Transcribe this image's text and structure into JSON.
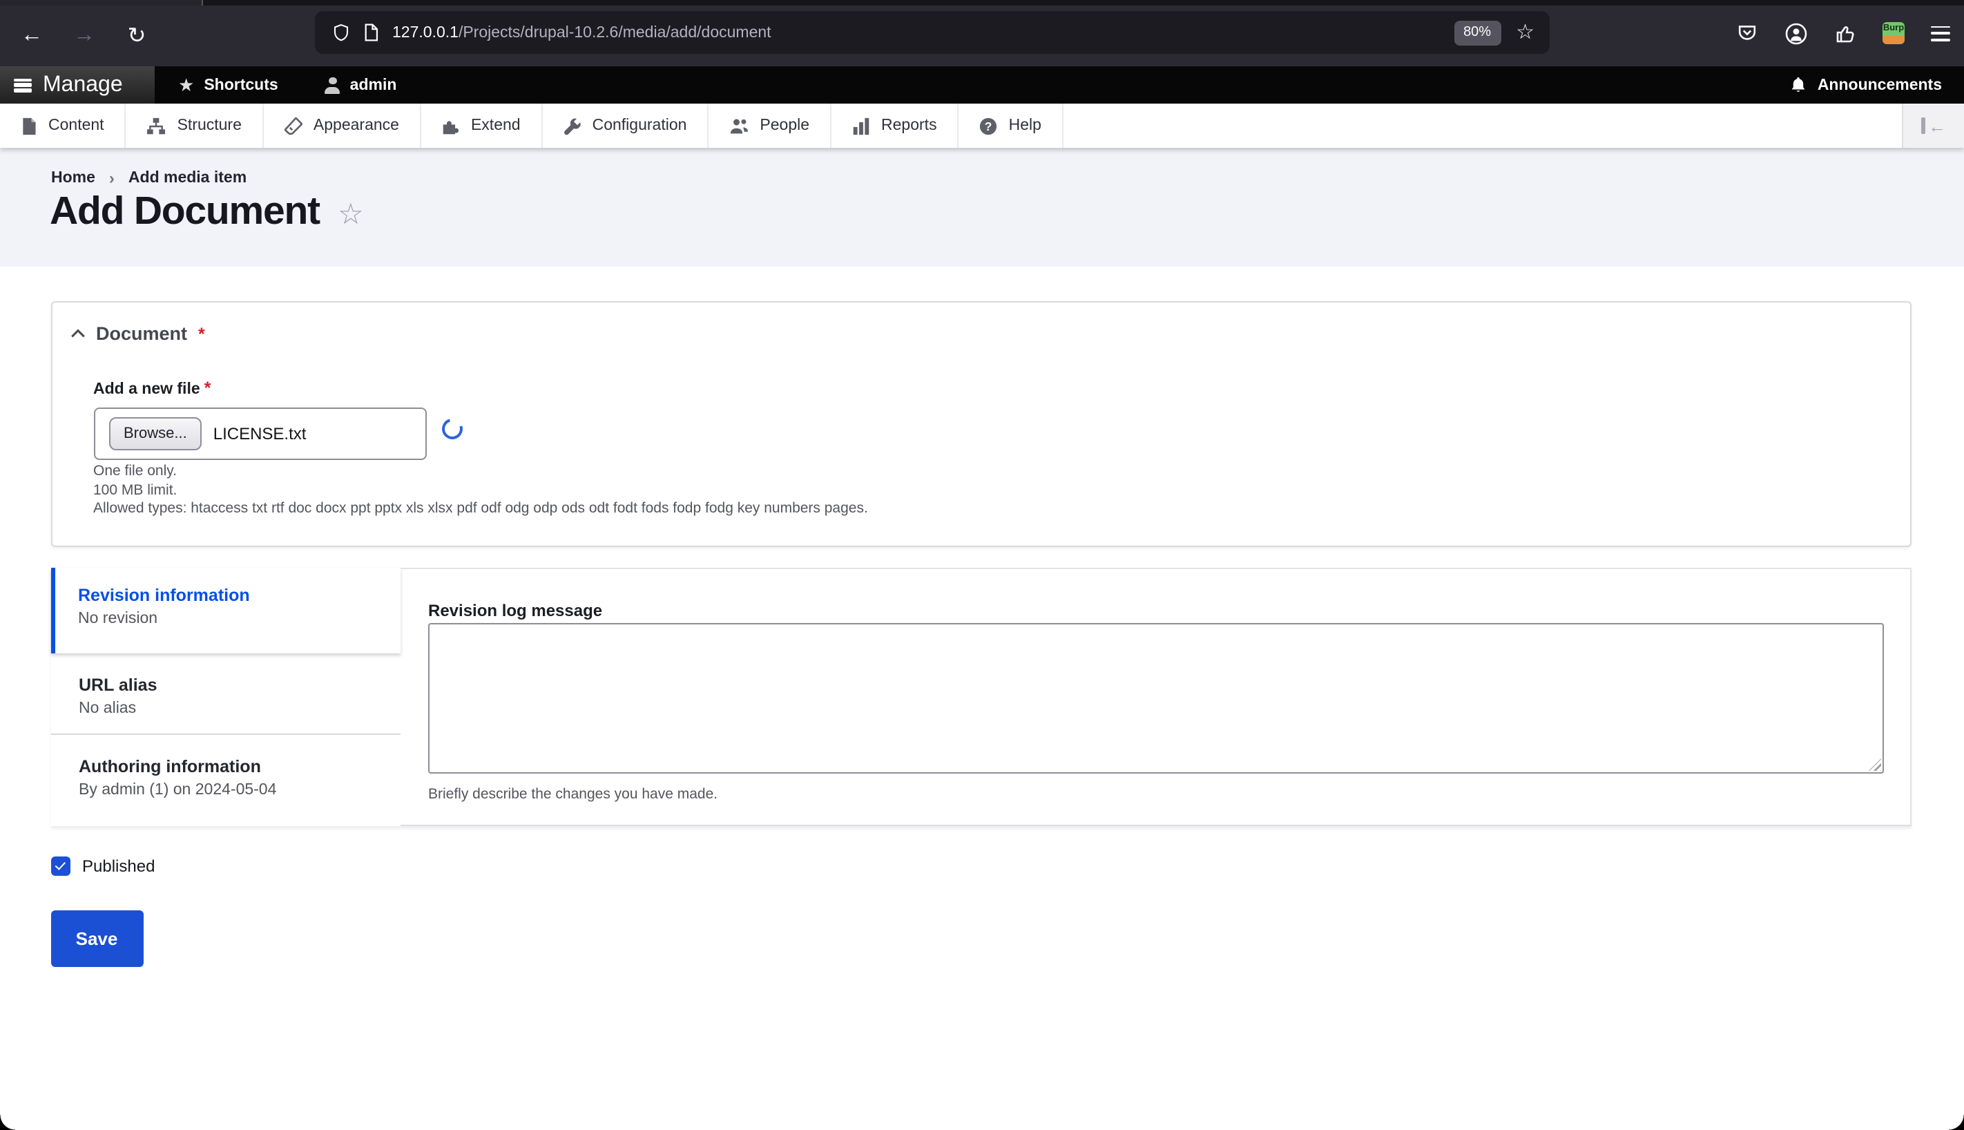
{
  "browser": {
    "url_host": "127.0.0.1",
    "url_path": "/Projects/drupal-10.2.6/media/add/document",
    "zoom_level": "80%",
    "extension_badge": "Burp"
  },
  "admin_toolbar": {
    "manage": "Manage",
    "shortcuts": "Shortcuts",
    "user": "admin",
    "announcements": "Announcements"
  },
  "menu_bar": {
    "items": [
      "Content",
      "Structure",
      "Appearance",
      "Extend",
      "Configuration",
      "People",
      "Reports",
      "Help"
    ]
  },
  "breadcrumb": {
    "home": "Home",
    "separator": "›",
    "current": "Add media item"
  },
  "page": {
    "title": "Add Document"
  },
  "document_section": {
    "legend": "Document",
    "required_mark": "*",
    "file_label": "Add a new file",
    "browse_button": "Browse...",
    "file_name": "LICENSE.txt",
    "hint_1": "One file only.",
    "hint_2": "100 MB limit.",
    "hint_3": "Allowed types: htaccess txt rtf doc docx ppt pptx xls xlsx pdf odf odg odp ods odt fodt fods fodp fodg key numbers pages."
  },
  "vertical_tabs": {
    "tabs": [
      {
        "label": "Revision information",
        "summary": "No revision",
        "active": true
      },
      {
        "label": "URL alias",
        "summary": "No alias",
        "active": false
      },
      {
        "label": "Authoring information",
        "summary": "By admin (1) on 2024-05-04",
        "active": false
      }
    ]
  },
  "revision_pane": {
    "label": "Revision log message",
    "value": "",
    "description": "Briefly describe the changes you have made."
  },
  "status": {
    "published_label": "Published",
    "checked": true
  },
  "actions": {
    "save": "Save"
  },
  "icons": {
    "back_arrow": "←",
    "forward_arrow": "→",
    "reload": "↻",
    "star_outline": "☆",
    "star_filled": "★",
    "toggle_arrow": "←"
  },
  "colors": {
    "primary_blue": "#1b4fd4",
    "active_tab_blue": "#0550e6",
    "required_red": "#d2222c",
    "header_bg": "#f2f3f9",
    "chrome_bg": "#2b2a33",
    "urlbar_bg": "#1c1b22"
  }
}
